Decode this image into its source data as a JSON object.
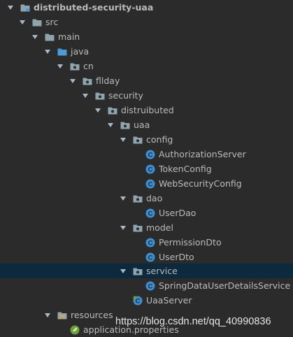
{
  "project_tree": {
    "root": "distributed-security-uaa",
    "src": "src",
    "main": "main",
    "java": "java",
    "cn": "cn",
    "fllday": "fllday",
    "security": "security",
    "distruibuted": "distruibuted",
    "uaa": "uaa",
    "config": "config",
    "authorization_server": "AuthorizationServer",
    "token_config": "TokenConfig",
    "web_security_config": "WebSecurityConfig",
    "dao": "dao",
    "user_dao": "UserDao",
    "model": "model",
    "permission_dto": "PermissionDto",
    "user_dto": "UserDto",
    "service": "service",
    "spring_data_user_details_service": "SpringDataUserDetailsService",
    "uaa_server": "UaaServer",
    "resources": "resources",
    "application_properties": "application.properties"
  },
  "watermark": "https://blog.csdn.net/qq_40990836",
  "colors": {
    "background": "#2b2b2b",
    "selection": "#0d293e",
    "text": "#bbbbbb",
    "folder": "#90a4ae",
    "source_folder": "#4a9bd8",
    "class_icon": "#3d8fd1",
    "spring_icon": "#6a9f3a"
  }
}
